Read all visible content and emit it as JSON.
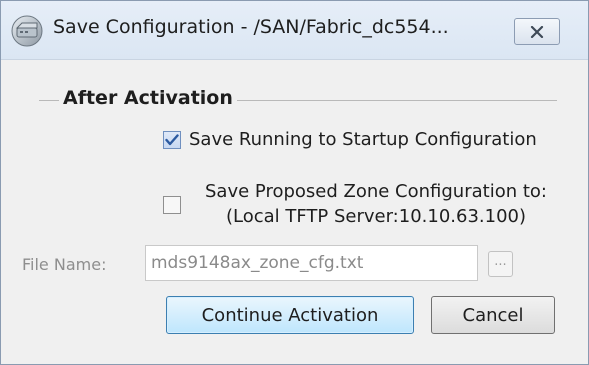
{
  "window": {
    "title": "Save Configuration - /SAN/Fabric_dc554...",
    "icon": "network-device-icon",
    "close_icon": "close-icon"
  },
  "group": {
    "title": "After Activation"
  },
  "options": {
    "save_running": {
      "label": "Save Running to Startup Configuration",
      "checked": true
    },
    "save_proposed": {
      "label_line1": "Save Proposed Zone Configuration to:",
      "label_line2": "(Local TFTP Server:10.10.63.100)",
      "checked": false
    }
  },
  "file": {
    "label": "File Name:",
    "value": "mds9148ax_zone_cfg.txt",
    "browse_label": "..."
  },
  "buttons": {
    "continue_label": "Continue Activation",
    "cancel_label": "Cancel"
  },
  "colors": {
    "accent_border": "#3c7fb1",
    "check_mark": "#2c5aa0",
    "disabled_text": "#8e8e8e"
  }
}
